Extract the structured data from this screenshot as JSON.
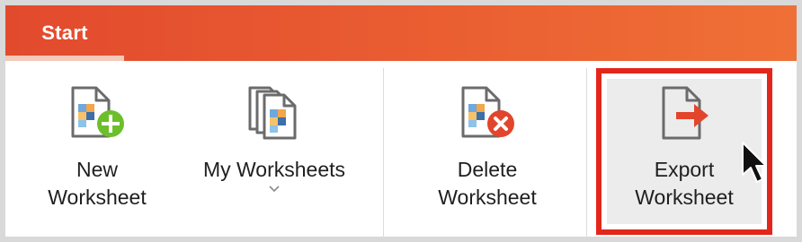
{
  "tab": {
    "label": "Start"
  },
  "commands": [
    {
      "id": "new",
      "label": "New\nWorksheet",
      "icon": "new-worksheet-icon"
    },
    {
      "id": "my",
      "label": "My Worksheets",
      "icon": "my-worksheets-icon",
      "has_dropdown": true
    },
    {
      "id": "delete",
      "label": "Delete\nWorksheet",
      "icon": "delete-worksheet-icon"
    },
    {
      "id": "export",
      "label": "Export\nWorksheet",
      "icon": "export-worksheet-icon",
      "highlighted": true
    }
  ],
  "colors": {
    "titlebar_start": "#e24a2d",
    "titlebar_end": "#ef7036",
    "highlight_border": "#e3261b",
    "add_badge": "#6cbf2a",
    "delete_badge": "#e2452c",
    "export_arrow": "#e2452c"
  }
}
